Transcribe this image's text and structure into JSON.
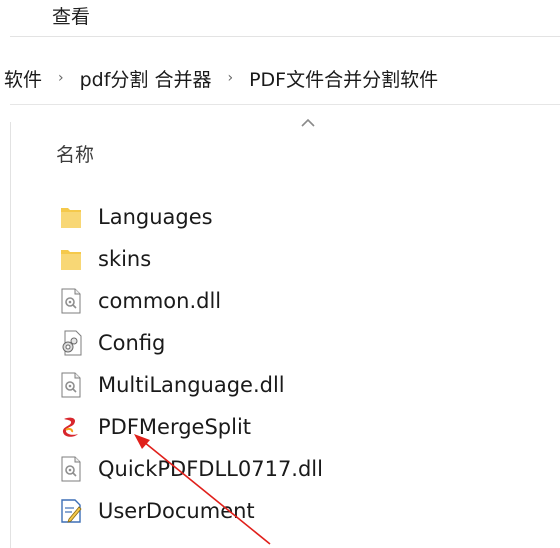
{
  "ribbon": {
    "tab_label": "查看"
  },
  "address_bar": {
    "crumbs": [
      "软件",
      "pdf分割 合并器",
      "PDF文件合并分割软件"
    ],
    "separator": "›"
  },
  "file_list": {
    "column_header": "名称",
    "items": [
      {
        "name": "Languages",
        "icon": "folder-icon"
      },
      {
        "name": "skins",
        "icon": "folder-icon"
      },
      {
        "name": "common.dll",
        "icon": "dll-file-icon"
      },
      {
        "name": "Config",
        "icon": "config-file-icon"
      },
      {
        "name": "MultiLanguage.dll",
        "icon": "dll-file-icon"
      },
      {
        "name": "PDFMergeSplit",
        "icon": "app-executable-icon"
      },
      {
        "name": "QuickPDFDLL0717.dll",
        "icon": "dll-file-icon"
      },
      {
        "name": "UserDocument",
        "icon": "document-shortcut-icon"
      }
    ]
  },
  "colors": {
    "folder": "#f5c94b",
    "annotation_arrow": "#e0201b",
    "app_icon": "#d8262d"
  }
}
